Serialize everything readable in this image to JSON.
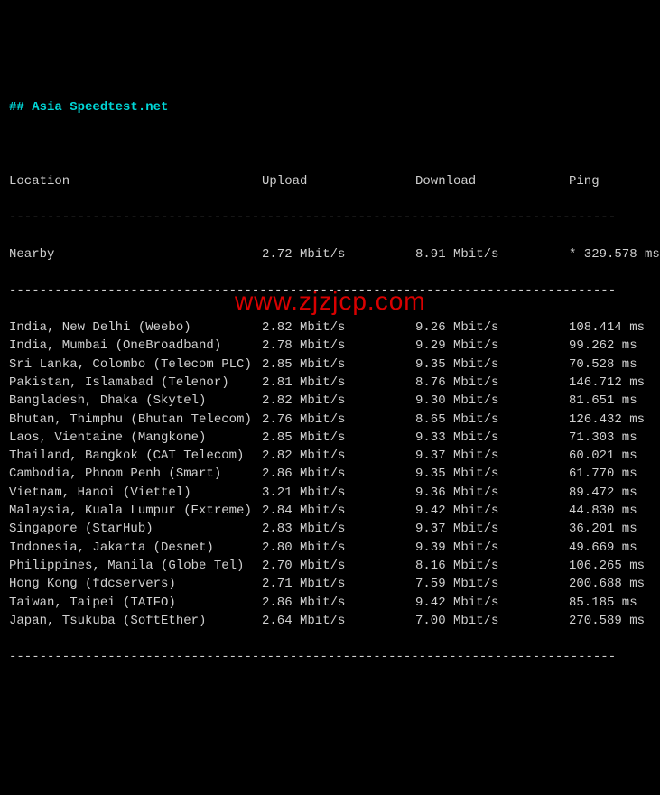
{
  "title": "## Asia Speedtest.net",
  "headers": {
    "location": "Location",
    "upload": "Upload",
    "download": "Download",
    "ping": "Ping"
  },
  "nearby": {
    "location": "Nearby",
    "upload": "2.72 Mbit/s",
    "download": "8.91 Mbit/s",
    "ping": "* 329.578 ms"
  },
  "rows": [
    {
      "location": "India, New Delhi (Weebo)",
      "upload": "2.82 Mbit/s",
      "download": "9.26 Mbit/s",
      "ping": "108.414 ms"
    },
    {
      "location": "India, Mumbai (OneBroadband)",
      "upload": "2.78 Mbit/s",
      "download": "9.29 Mbit/s",
      "ping": "99.262 ms"
    },
    {
      "location": "Sri Lanka, Colombo (Telecom PLC)",
      "upload": "2.85 Mbit/s",
      "download": "9.35 Mbit/s",
      "ping": "70.528 ms"
    },
    {
      "location": "Pakistan, Islamabad (Telenor)",
      "upload": "2.81 Mbit/s",
      "download": "8.76 Mbit/s",
      "ping": "146.712 ms"
    },
    {
      "location": "Bangladesh, Dhaka (Skytel)",
      "upload": "2.82 Mbit/s",
      "download": "9.30 Mbit/s",
      "ping": "81.651 ms"
    },
    {
      "location": "Bhutan, Thimphu (Bhutan Telecom)",
      "upload": "2.76 Mbit/s",
      "download": "8.65 Mbit/s",
      "ping": "126.432 ms"
    },
    {
      "location": "Laos, Vientaine (Mangkone)",
      "upload": "2.85 Mbit/s",
      "download": "9.33 Mbit/s",
      "ping": "71.303 ms"
    },
    {
      "location": "Thailand, Bangkok (CAT Telecom)",
      "upload": "2.82 Mbit/s",
      "download": "9.37 Mbit/s",
      "ping": "60.021 ms"
    },
    {
      "location": "Cambodia, Phnom Penh (Smart)",
      "upload": "2.86 Mbit/s",
      "download": "9.35 Mbit/s",
      "ping": "61.770 ms"
    },
    {
      "location": "Vietnam, Hanoi (Viettel)",
      "upload": "3.21 Mbit/s",
      "download": "9.36 Mbit/s",
      "ping": "89.472 ms"
    },
    {
      "location": "Malaysia, Kuala Lumpur (Extreme)",
      "upload": "2.84 Mbit/s",
      "download": "9.42 Mbit/s",
      "ping": "44.830 ms"
    },
    {
      "location": "Singapore (StarHub)",
      "upload": "2.83 Mbit/s",
      "download": "9.37 Mbit/s",
      "ping": "36.201 ms"
    },
    {
      "location": "Indonesia, Jakarta (Desnet)",
      "upload": "2.80 Mbit/s",
      "download": "9.39 Mbit/s",
      "ping": "49.669 ms"
    },
    {
      "location": "Philippines, Manila (Globe Tel)",
      "upload": "2.70 Mbit/s",
      "download": "8.16 Mbit/s",
      "ping": "106.265 ms"
    },
    {
      "location": "Hong Kong (fdcservers)",
      "upload": "2.71 Mbit/s",
      "download": "7.59 Mbit/s",
      "ping": "200.688 ms"
    },
    {
      "location": "Taiwan, Taipei (TAIFO)",
      "upload": "2.86 Mbit/s",
      "download": "9.42 Mbit/s",
      "ping": "85.185 ms"
    },
    {
      "location": "Japan, Tsukuba (SoftEther)",
      "upload": "2.64 Mbit/s",
      "download": "7.00 Mbit/s",
      "ping": "270.589 ms"
    }
  ],
  "divider": "--------------------------------------------------------------------------------",
  "watermark": "www.zjzjcp.com"
}
